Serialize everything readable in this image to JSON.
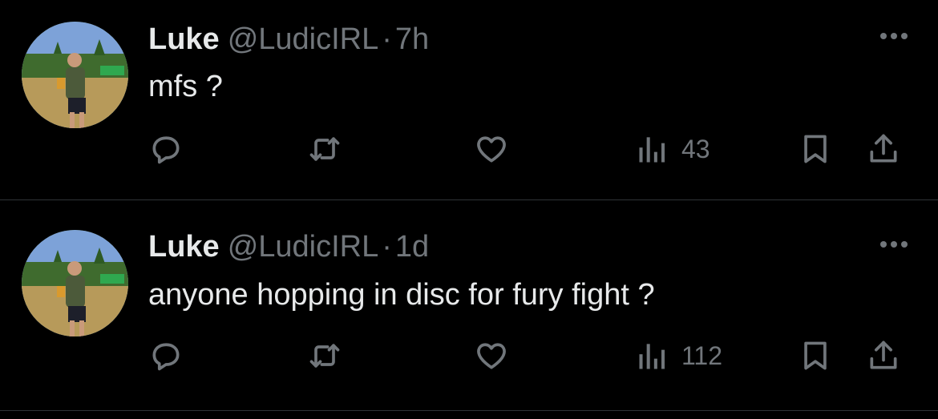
{
  "colors": {
    "background": "#000000",
    "text_primary": "#e7e9ea",
    "text_secondary": "#71767b",
    "divider": "#2f3336"
  },
  "tweets": [
    {
      "author_name": "Luke",
      "author_handle": "@LudicIRL",
      "separator": "·",
      "time": "7h",
      "text": "mfs ?",
      "views": "43",
      "icons": [
        "reply-icon",
        "retweet-icon",
        "like-icon",
        "views-icon",
        "bookmark-icon",
        "share-icon",
        "more-icon"
      ]
    },
    {
      "author_name": "Luke",
      "author_handle": "@LudicIRL",
      "separator": "·",
      "time": "1d",
      "text": "anyone hopping in disc for fury fight ?",
      "views": "112",
      "icons": [
        "reply-icon",
        "retweet-icon",
        "like-icon",
        "views-icon",
        "bookmark-icon",
        "share-icon",
        "more-icon"
      ]
    }
  ]
}
